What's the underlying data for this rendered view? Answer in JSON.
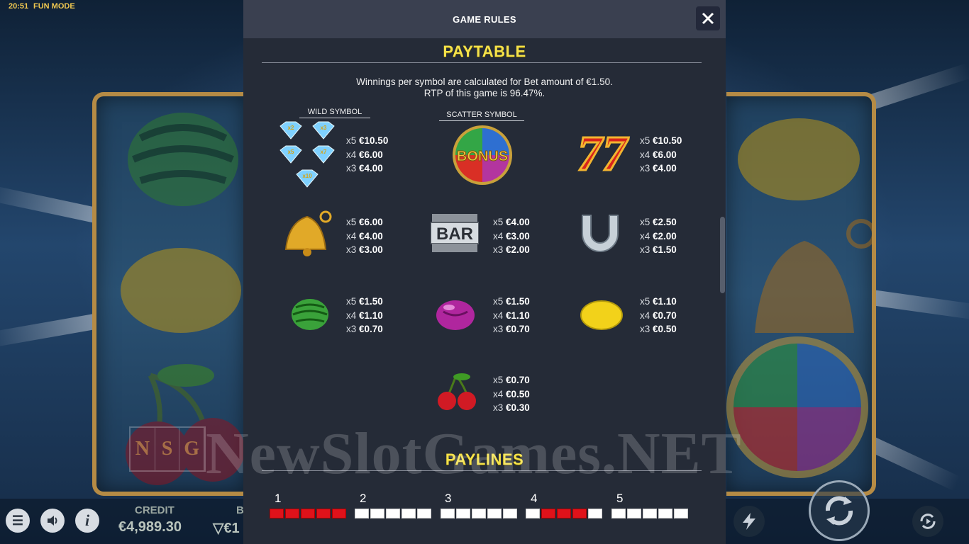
{
  "status": {
    "time": "20:51",
    "mode": "FUN MODE"
  },
  "modal": {
    "title": "GAME RULES",
    "paytable_heading": "PAYTABLE",
    "info_line1": "Winnings per symbol are calculated for Bet amount of €1.50.",
    "info_line2": "RTP of this game is 96.47%.",
    "wild_label": "WILD SYMBOL",
    "scatter_label": "SCATTER SYMBOL",
    "paylines_heading": "PAYLINES"
  },
  "payouts": {
    "wild": {
      "x5": "€10.50",
      "x4": "€6.00",
      "x3": "€4.00"
    },
    "seven": {
      "x5": "€10.50",
      "x4": "€6.00",
      "x3": "€4.00"
    },
    "bell": {
      "x5": "€6.00",
      "x4": "€4.00",
      "x3": "€3.00"
    },
    "bar": {
      "x5": "€4.00",
      "x4": "€3.00",
      "x3": "€2.00"
    },
    "horseshoe": {
      "x5": "€2.50",
      "x4": "€2.00",
      "x3": "€1.50"
    },
    "watermelon": {
      "x5": "€1.50",
      "x4": "€1.10",
      "x3": "€0.70"
    },
    "plum": {
      "x5": "€1.50",
      "x4": "€1.10",
      "x3": "€0.70"
    },
    "lemon": {
      "x5": "€1.10",
      "x4": "€0.70",
      "x3": "€0.50"
    },
    "cherry": {
      "x5": "€0.70",
      "x4": "€0.50",
      "x3": "€0.30"
    }
  },
  "multiplier_labels": {
    "x5": "x5",
    "x4": "x4",
    "x3": "x3"
  },
  "symbols": {
    "bar_text": "BAR",
    "bonus_text": "BONUS",
    "seven_text": "77",
    "gem_labels": [
      "x2",
      "x3",
      "x5",
      "x7",
      "x10"
    ]
  },
  "paylines": [
    {
      "number": "1",
      "cells": [
        1,
        1,
        1,
        1,
        1
      ]
    },
    {
      "number": "2",
      "cells": [
        0,
        0,
        0,
        0,
        0
      ]
    },
    {
      "number": "3",
      "cells": [
        0,
        0,
        0,
        0,
        0
      ]
    },
    {
      "number": "4",
      "cells": [
        0,
        1,
        1,
        1,
        0
      ]
    },
    {
      "number": "5",
      "cells": [
        0,
        0,
        0,
        0,
        0
      ]
    }
  ],
  "bottom": {
    "credit_label": "CREDIT",
    "credit_value": "€4,989.30",
    "bet_label": "B",
    "bet_value": "▽€1"
  },
  "watermark": {
    "text": "NewSlotGames.NET",
    "logo_letters": [
      "N",
      "S",
      "G"
    ]
  },
  "colors": {
    "accent_yellow": "#f5e24a",
    "payline_red": "#e0121a",
    "modal_bg": "#252b37"
  }
}
